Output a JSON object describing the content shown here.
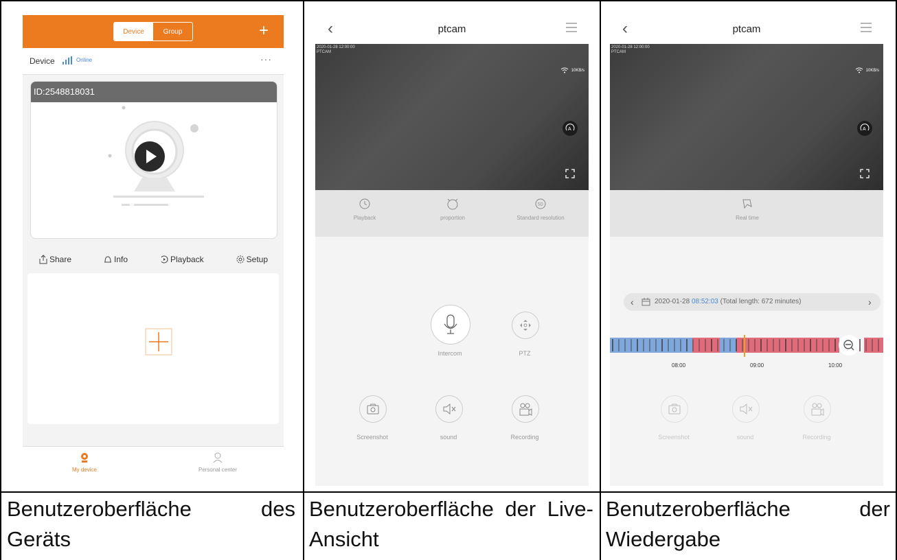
{
  "panel1": {
    "segment": {
      "device": "Device",
      "group": "Group"
    },
    "plus_icon": "plus-icon",
    "device_name": "Device",
    "status": "Online",
    "more": "···",
    "card_id": "ID:2548818031",
    "actions": [
      {
        "label": "Share",
        "icon": "share-icon"
      },
      {
        "label": "Info",
        "icon": "bell-icon"
      },
      {
        "label": "Playback",
        "icon": "playback-icon"
      },
      {
        "label": "Setup",
        "icon": "gear-icon"
      }
    ],
    "tabs": {
      "my_device": "My device",
      "personal_center": "Personal center"
    },
    "accent": "#ec7a1f"
  },
  "panel2": {
    "title": "ptcam",
    "osd": "2020-01-28 12:00:00",
    "osd2": "PTCAM",
    "rate": "10KB/s",
    "toolbar": [
      "Playback",
      "proportion",
      "Standard resolution"
    ],
    "controls": {
      "intercom": "Intercom",
      "ptz": "PTZ",
      "screenshot": "Screenshot",
      "sound": "sound",
      "recording": "Recording"
    }
  },
  "panel3": {
    "title": "ptcam",
    "osd": "2020-01-28 12:00:00",
    "osd2": "PTCAM",
    "rate": "10KB/s",
    "realtime": "Real time",
    "date": "2020-01-28",
    "time": "08:52:03",
    "total": "(Total length: 672 minutes)",
    "ticks": [
      "08:00",
      "09:00",
      "10:00"
    ],
    "controls": {
      "screenshot": "Screenshot",
      "sound": "sound",
      "recording": "Recording"
    }
  },
  "captions": {
    "c1": "Benutzeroberfläche des Geräts",
    "c2": "Benutzeroberfläche der Live-Ansicht",
    "c3": "Benutzeroberfläche der Wiedergabe"
  }
}
